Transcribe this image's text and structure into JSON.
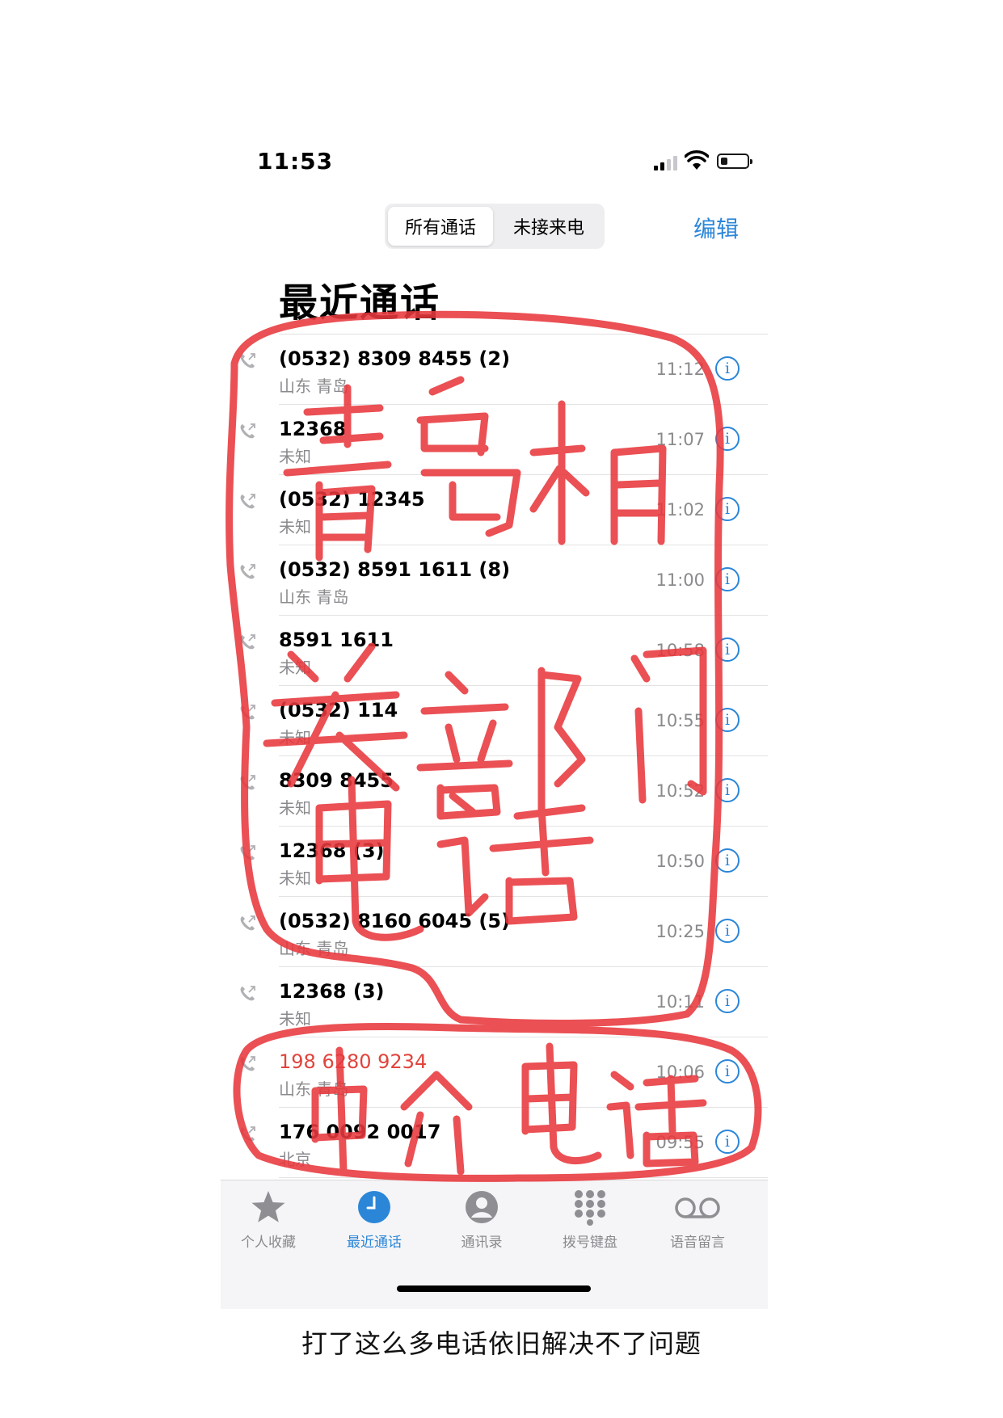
{
  "status_bar": {
    "time": "11:53"
  },
  "header": {
    "segments": [
      "所有通话",
      "未接来电"
    ],
    "edit_label": "编辑",
    "title": "最近通话"
  },
  "calls": [
    {
      "number": "(0532) 8309 8455 (2)",
      "location": "山东 青岛",
      "time": "11:12",
      "missed": false
    },
    {
      "number": "12368",
      "location": "未知",
      "time": "11:07",
      "missed": false
    },
    {
      "number": "(0532) 12345",
      "location": "未知",
      "time": "11:02",
      "missed": false
    },
    {
      "number": "(0532) 8591 1611 (8)",
      "location": "山东 青岛",
      "time": "11:00",
      "missed": false
    },
    {
      "number": "8591 1611",
      "location": "未知",
      "time": "10:58",
      "missed": false
    },
    {
      "number": "(0532) 114",
      "location": "未知",
      "time": "10:55",
      "missed": false
    },
    {
      "number": "8309 8455",
      "location": "未知",
      "time": "10:52",
      "missed": false
    },
    {
      "number": "12368 (3)",
      "location": "未知",
      "time": "10:50",
      "missed": false
    },
    {
      "number": "(0532) 8160 6045 (5)",
      "location": "山东 青岛",
      "time": "10:25",
      "missed": false
    },
    {
      "number": "12368 (3)",
      "location": "未知",
      "time": "10:11",
      "missed": false
    },
    {
      "number": "198 6280 9234",
      "location": "山东 青岛",
      "time": "10:06",
      "missed": true
    },
    {
      "number": "176 0092 0017",
      "location": "北京",
      "time": "09:55",
      "missed": false
    }
  ],
  "tabbar": [
    {
      "label": "个人收藏",
      "icon": "star-icon",
      "active": false
    },
    {
      "label": "最近通话",
      "icon": "clock-icon",
      "active": true
    },
    {
      "label": "通讯录",
      "icon": "contact-icon",
      "active": false
    },
    {
      "label": "拨号键盘",
      "icon": "keypad-icon",
      "active": false
    },
    {
      "label": "语音留言",
      "icon": "voicemail-icon",
      "active": false
    }
  ],
  "caption": "打了这么多电话依旧解决不了问题",
  "annotations": {
    "color": "#e8383d",
    "top_text": "青岛相关部门电话",
    "bottom_text": "中介电话"
  },
  "colors": {
    "accent": "#2b86d8",
    "missed": "#e0443c",
    "secondary_text": "#8a8a8e"
  }
}
